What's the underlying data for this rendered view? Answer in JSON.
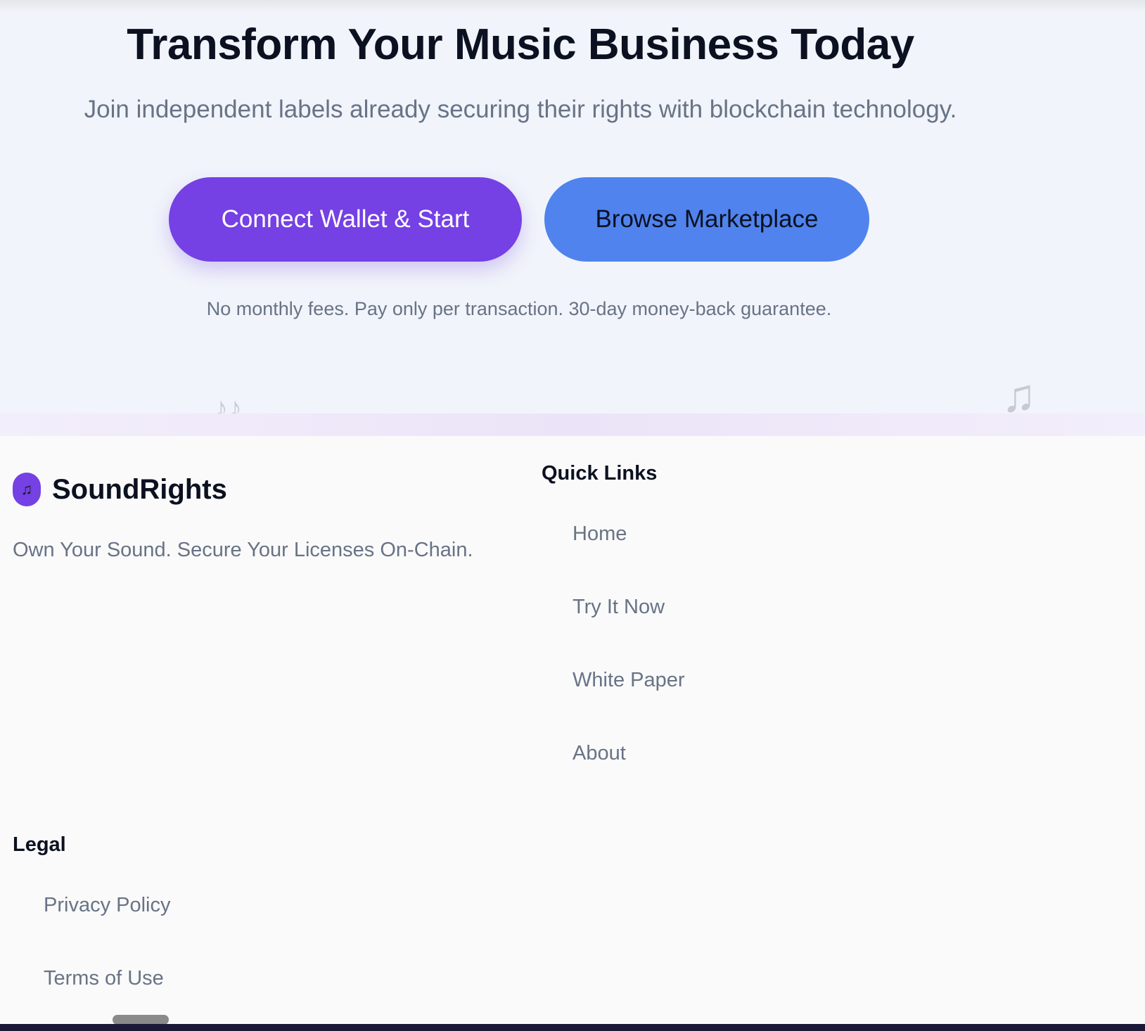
{
  "hero": {
    "title": "Transform Your Music Business Today",
    "subtitle": "Join independent labels already securing their rights with blockchain technology.",
    "primary_button": "Connect Wallet & Start",
    "secondary_button": "Browse Marketplace",
    "note": "No monthly fees. Pay only per transaction. 30-day money-back guarantee.",
    "deco_icons": [
      "♪♪",
      "♫"
    ]
  },
  "footer": {
    "brand": {
      "logo_icon": "♫",
      "name": "SoundRights",
      "tagline": "Own Your Sound. Secure Your Licenses On-Chain."
    },
    "quick_links": {
      "heading": "Quick Links",
      "items": [
        "Home",
        "Try It Now",
        "White Paper",
        "About"
      ]
    },
    "legal": {
      "heading": "Legal",
      "items": [
        "Privacy Policy",
        "Terms of Use"
      ]
    }
  },
  "colors": {
    "primary": "#7540e4",
    "secondary": "#5083ee",
    "heading": "#0b1120",
    "muted_text": "#687386",
    "hero_background": "#f1f4fa",
    "footer_background": "#fafafa"
  }
}
